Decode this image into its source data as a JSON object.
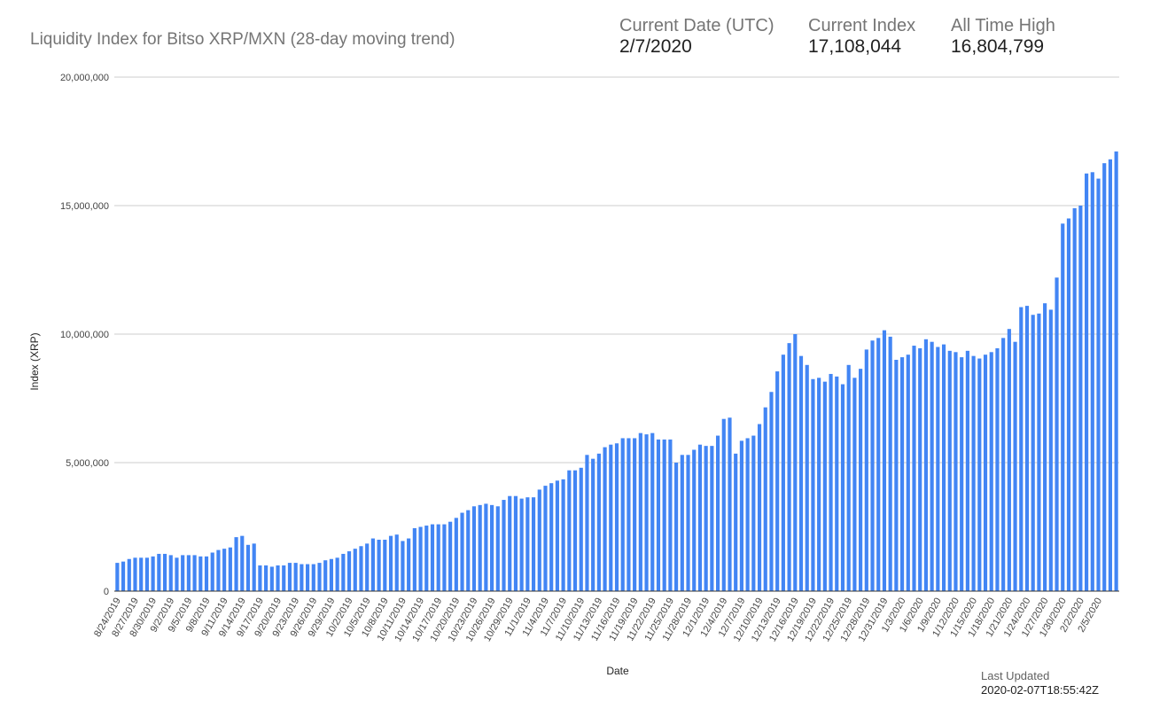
{
  "header": {
    "title": "Liquidity Index for Bitso XRP/MXN (28-day moving trend)",
    "stats": [
      {
        "label": "Current Date (UTC)",
        "value": "2/7/2020"
      },
      {
        "label": "Current Index",
        "value": "17,108,044"
      },
      {
        "label": "All Time High",
        "value": "16,804,799"
      }
    ]
  },
  "footer": {
    "label": "Last Updated",
    "value": "2020-02-07T18:55:42Z"
  },
  "chart_data": {
    "type": "bar",
    "title": "",
    "xlabel": "Date",
    "ylabel": "Index (XRP)",
    "ylim": [
      0,
      20000000
    ],
    "yticks": [
      0,
      5000000,
      10000000,
      15000000,
      20000000
    ],
    "ytick_labels": [
      "0",
      "5,000,000",
      "10,000,000",
      "15,000,000",
      "20,000,000"
    ],
    "xtick_labels": [
      "8/24/2019",
      "8/27/2019",
      "8/30/2019",
      "9/2/2019",
      "9/5/2019",
      "9/8/2019",
      "9/11/2019",
      "9/14/2019",
      "9/17/2019",
      "9/20/2019",
      "9/23/2019",
      "9/26/2019",
      "9/29/2019",
      "10/2/2019",
      "10/5/2019",
      "10/8/2019",
      "10/11/2019",
      "10/14/2019",
      "10/17/2019",
      "10/20/2019",
      "10/23/2019",
      "10/26/2019",
      "10/29/2019",
      "11/1/2019",
      "11/4/2019",
      "11/7/2019",
      "11/10/2019",
      "11/13/2019",
      "11/16/2019",
      "11/19/2019",
      "11/22/2019",
      "11/25/2019",
      "11/28/2019",
      "12/1/2019",
      "12/4/2019",
      "12/7/2019",
      "12/10/2019",
      "12/13/2019",
      "12/16/2019",
      "12/19/2019",
      "12/22/2019",
      "12/25/2019",
      "12/28/2019",
      "12/31/2019",
      "1/3/2020",
      "1/6/2020",
      "1/9/2020",
      "1/12/2020",
      "1/15/2020",
      "1/18/2020",
      "1/21/2020",
      "1/24/2020",
      "1/27/2020",
      "1/30/2020",
      "2/2/2020",
      "2/5/2020"
    ],
    "start_date": "8/24/2019",
    "grid": true,
    "color": "#4285f4",
    "values": [
      1100000,
      1150000,
      1250000,
      1300000,
      1300000,
      1300000,
      1350000,
      1450000,
      1450000,
      1400000,
      1300000,
      1400000,
      1400000,
      1400000,
      1350000,
      1350000,
      1500000,
      1600000,
      1650000,
      1700000,
      2100000,
      2150000,
      1800000,
      1850000,
      1000000,
      1000000,
      950000,
      1000000,
      1000000,
      1100000,
      1100000,
      1050000,
      1050000,
      1050000,
      1100000,
      1200000,
      1250000,
      1300000,
      1450000,
      1550000,
      1650000,
      1750000,
      1850000,
      2050000,
      2000000,
      2000000,
      2150000,
      2200000,
      1950000,
      2050000,
      2450000,
      2500000,
      2550000,
      2600000,
      2600000,
      2600000,
      2700000,
      2850000,
      3050000,
      3150000,
      3300000,
      3350000,
      3400000,
      3350000,
      3300000,
      3550000,
      3700000,
      3700000,
      3600000,
      3650000,
      3650000,
      3950000,
      4100000,
      4200000,
      4300000,
      4350000,
      4700000,
      4700000,
      4800000,
      5300000,
      5150000,
      5350000,
      5600000,
      5700000,
      5750000,
      5950000,
      5950000,
      5950000,
      6150000,
      6100000,
      6150000,
      5900000,
      5900000,
      5900000,
      5000000,
      5300000,
      5300000,
      5500000,
      5700000,
      5650000,
      5650000,
      6050000,
      6700000,
      6750000,
      5350000,
      5850000,
      5950000,
      6050000,
      6500000,
      7150000,
      7750000,
      8550000,
      9200000,
      9650000,
      10000000,
      9150000,
      8800000,
      8250000,
      8300000,
      8150000,
      8450000,
      8350000,
      8050000,
      8800000,
      8300000,
      8650000,
      9400000,
      9750000,
      9850000,
      10150000,
      9900000,
      9000000,
      9100000,
      9200000,
      9550000,
      9450000,
      9800000,
      9700000,
      9500000,
      9600000,
      9350000,
      9300000,
      9100000,
      9350000,
      9150000,
      9050000,
      9200000,
      9300000,
      9450000,
      9850000,
      10200000,
      9700000,
      11050000,
      11100000,
      10750000,
      10800000,
      11200000,
      10950000,
      12200000,
      14300000,
      14500000,
      14900000,
      15000000,
      16250000,
      16300000,
      16050000,
      16650000,
      16800000,
      17108044
    ]
  }
}
